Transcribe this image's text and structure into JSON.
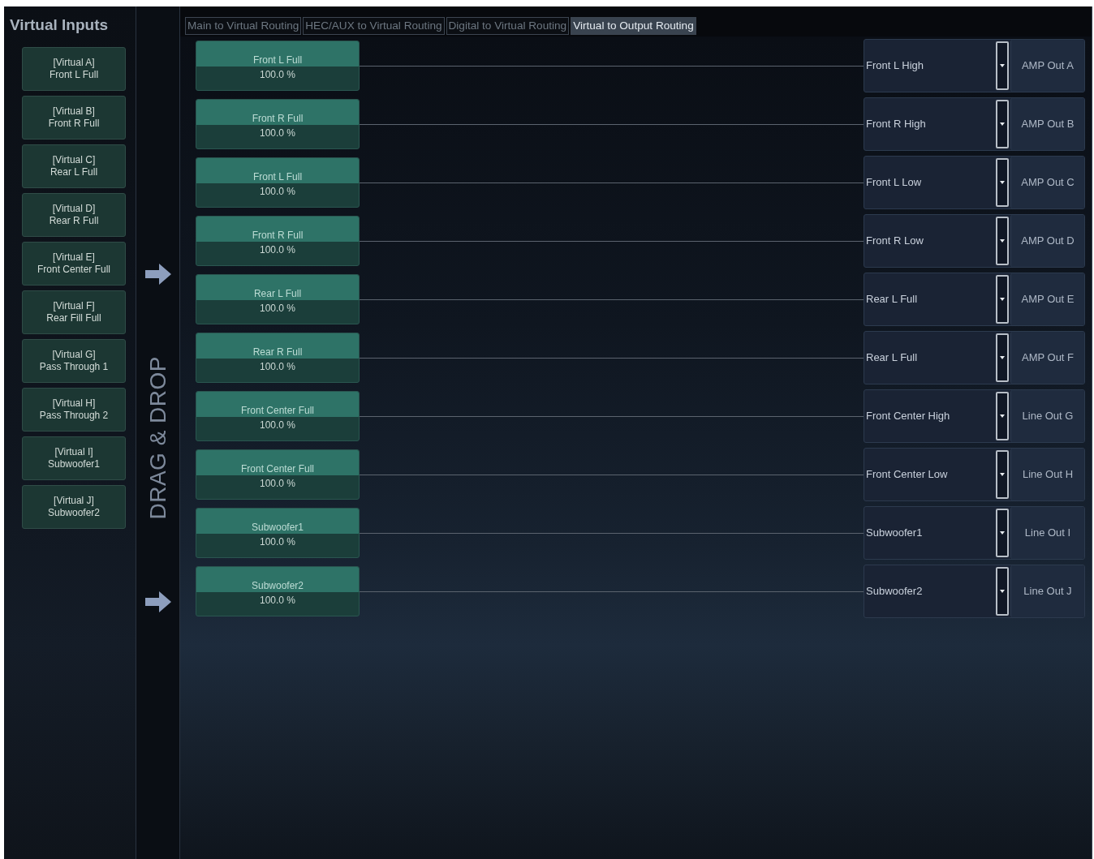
{
  "sidebar": {
    "title": "Virtual Inputs",
    "items": [
      {
        "name": "[Virtual A]",
        "source": "Front L Full"
      },
      {
        "name": "[Virtual B]",
        "source": "Front R Full"
      },
      {
        "name": "[Virtual C]",
        "source": "Rear L Full"
      },
      {
        "name": "[Virtual D]",
        "source": "Rear R Full"
      },
      {
        "name": "[Virtual E]",
        "source": "Front Center Full"
      },
      {
        "name": "[Virtual F]",
        "source": "Rear Fill Full"
      },
      {
        "name": "[Virtual G]",
        "source": "Pass Through 1"
      },
      {
        "name": "[Virtual H]",
        "source": "Pass Through 2"
      },
      {
        "name": "[Virtual I]",
        "source": "Subwoofer1"
      },
      {
        "name": "[Virtual J]",
        "source": "Subwoofer2"
      }
    ]
  },
  "drag_drop": {
    "label": "DRAG & DROP"
  },
  "tabs": [
    {
      "label": "Main to Virtual Routing",
      "selected": false
    },
    {
      "label": "HEC/AUX to Virtual Routing",
      "selected": false
    },
    {
      "label": "Digital to Virtual Routing",
      "selected": false
    },
    {
      "label": "Virtual to Output Routing",
      "selected": true
    }
  ],
  "routes": [
    {
      "input": "Front L Full",
      "gain": "100.0 %",
      "channel": "Front L High",
      "output": "AMP Out A"
    },
    {
      "input": "Front R Full",
      "gain": "100.0 %",
      "channel": "Front R High",
      "output": "AMP Out B"
    },
    {
      "input": "Front L Full",
      "gain": "100.0 %",
      "channel": "Front L Low",
      "output": "AMP Out C"
    },
    {
      "input": "Front R Full",
      "gain": "100.0 %",
      "channel": "Front R Low",
      "output": "AMP Out D"
    },
    {
      "input": "Rear L Full",
      "gain": "100.0 %",
      "channel": "Rear L Full",
      "output": "AMP Out E"
    },
    {
      "input": "Rear R Full",
      "gain": "100.0 %",
      "channel": "Rear L Full",
      "output": "AMP Out F"
    },
    {
      "input": "Front Center Full",
      "gain": "100.0 %",
      "channel": "Front Center High",
      "output": "Line Out G"
    },
    {
      "input": "Front Center Full",
      "gain": "100.0 %",
      "channel": "Front Center Low",
      "output": "Line Out H"
    },
    {
      "input": "Subwoofer1",
      "gain": "100.0 %",
      "channel": "Subwoofer1",
      "output": "Line Out I"
    },
    {
      "input": "Subwoofer2",
      "gain": "100.0 %",
      "channel": "Subwoofer2",
      "output": "Line Out J"
    }
  ]
}
